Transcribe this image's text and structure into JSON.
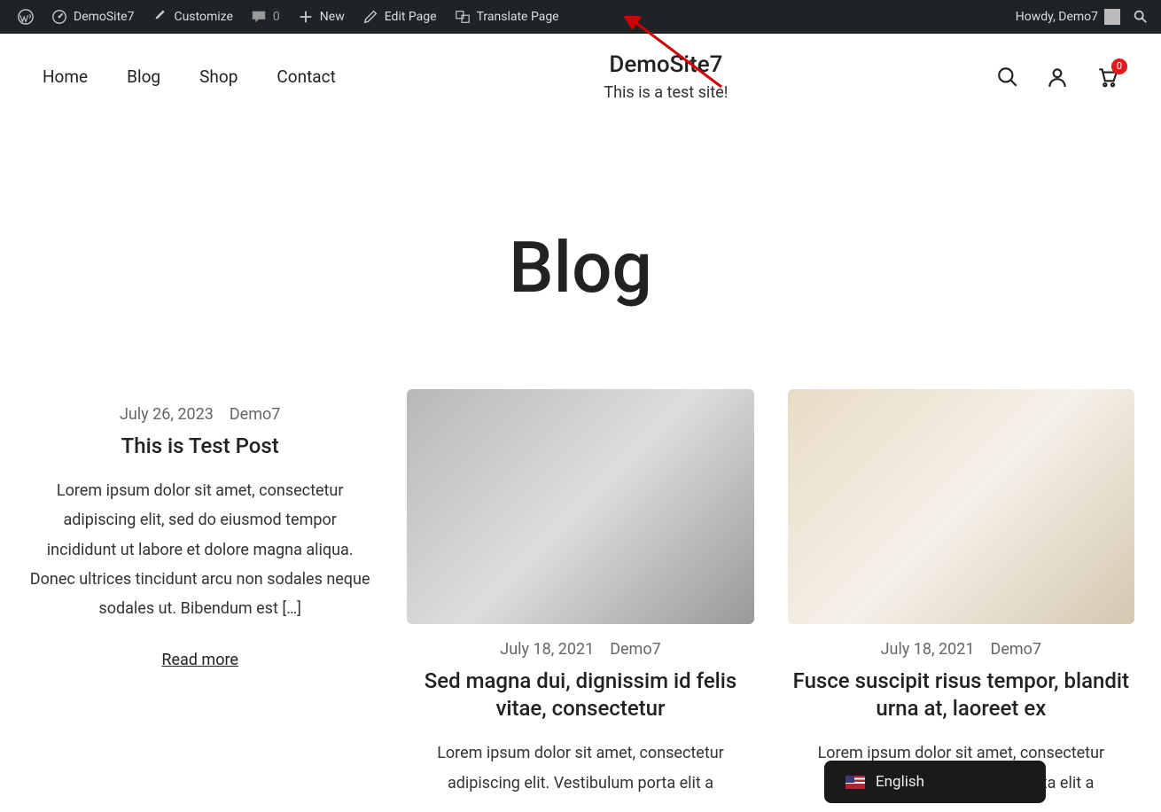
{
  "adminbar": {
    "site_name": "DemoSite7",
    "customize": "Customize",
    "comments": "0",
    "new": "New",
    "edit_page": "Edit Page",
    "translate_page": "Translate Page",
    "greeting": "Howdy, Demo7"
  },
  "nav": {
    "items": [
      "Home",
      "Blog",
      "Shop",
      "Contact"
    ]
  },
  "identity": {
    "title": "DemoSite7",
    "tagline": "This is a test site!"
  },
  "cart": {
    "count": "0"
  },
  "page": {
    "title": "Blog"
  },
  "posts": [
    {
      "date": "July 26, 2023",
      "author": "Demo7",
      "title": "This is Test Post",
      "excerpt": "Lorem ipsum dolor sit amet, consectetur adipiscing elit, sed do eiusmod tempor incididunt ut labore et dolore magna aliqua. Donec ultrices tincidunt arcu non sodales neque sodales ut. Bibendum est […]",
      "readmore": "Read more",
      "has_image": false
    },
    {
      "date": "July 18, 2021",
      "author": "Demo7",
      "title": "Sed magna dui, dignissim id felis vitae, consectetur",
      "excerpt": "Lorem ipsum dolor sit amet, consectetur adipiscing elit. Vestibulum porta elit a",
      "has_image": true,
      "image_class": "img-building"
    },
    {
      "date": "July 18, 2021",
      "author": "Demo7",
      "title": "Fusce suscipit risus tempor, blandit urna at, laoreet ex",
      "excerpt": "Lorem ipsum dolor sit amet, consectetur adipiscing elit. Vestibulum porta elit a",
      "has_image": true,
      "image_class": "img-bathroom"
    }
  ],
  "lang": {
    "current": "English"
  }
}
